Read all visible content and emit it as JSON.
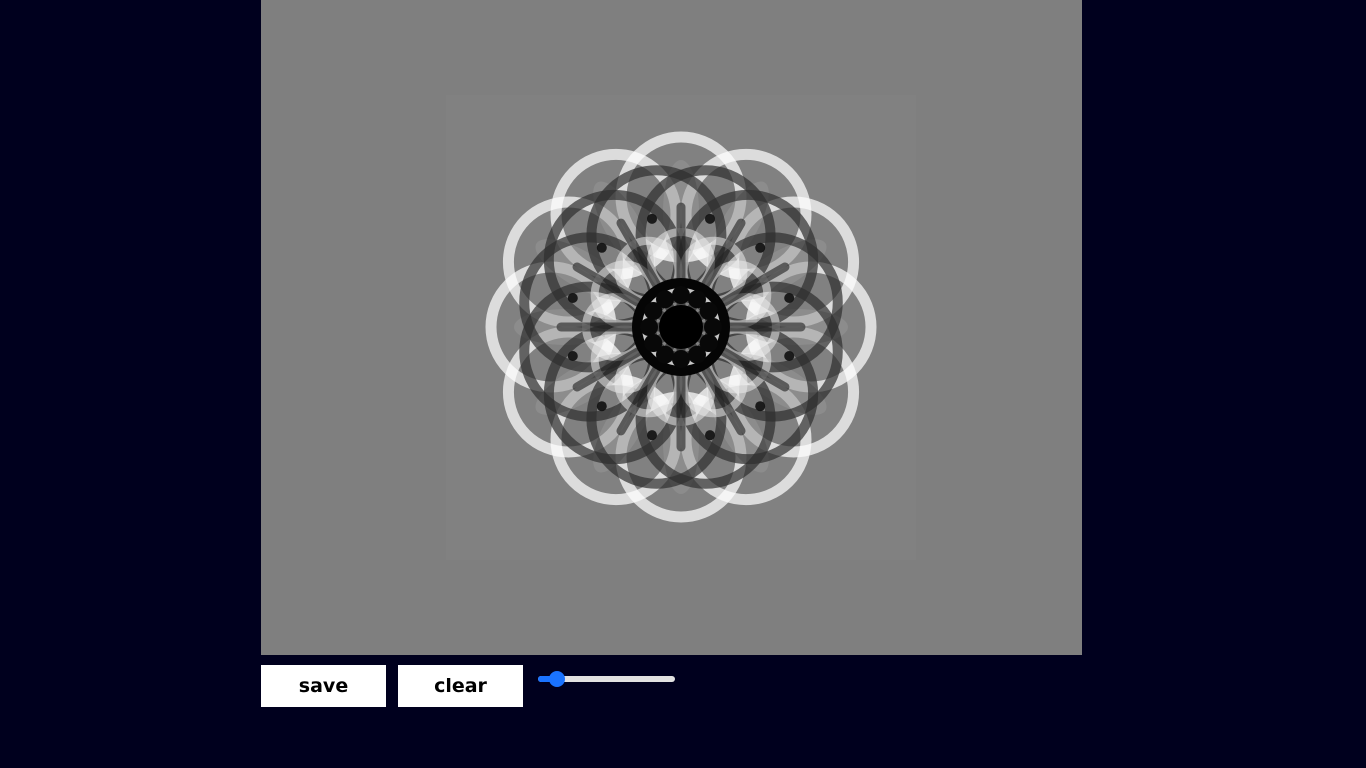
{
  "canvas": {
    "background": "#7f7f7f",
    "pattern": "kaleidoscope-rosette",
    "symmetry": 12,
    "colors": [
      "#000000",
      "#3a3a3a",
      "#ffffff"
    ]
  },
  "controls": {
    "save_label": "save",
    "clear_label": "clear",
    "slider": {
      "value": 0.14,
      "accent": "#1a73ff",
      "track": "#e2e2e2"
    }
  },
  "page": {
    "background": "#00001e"
  }
}
